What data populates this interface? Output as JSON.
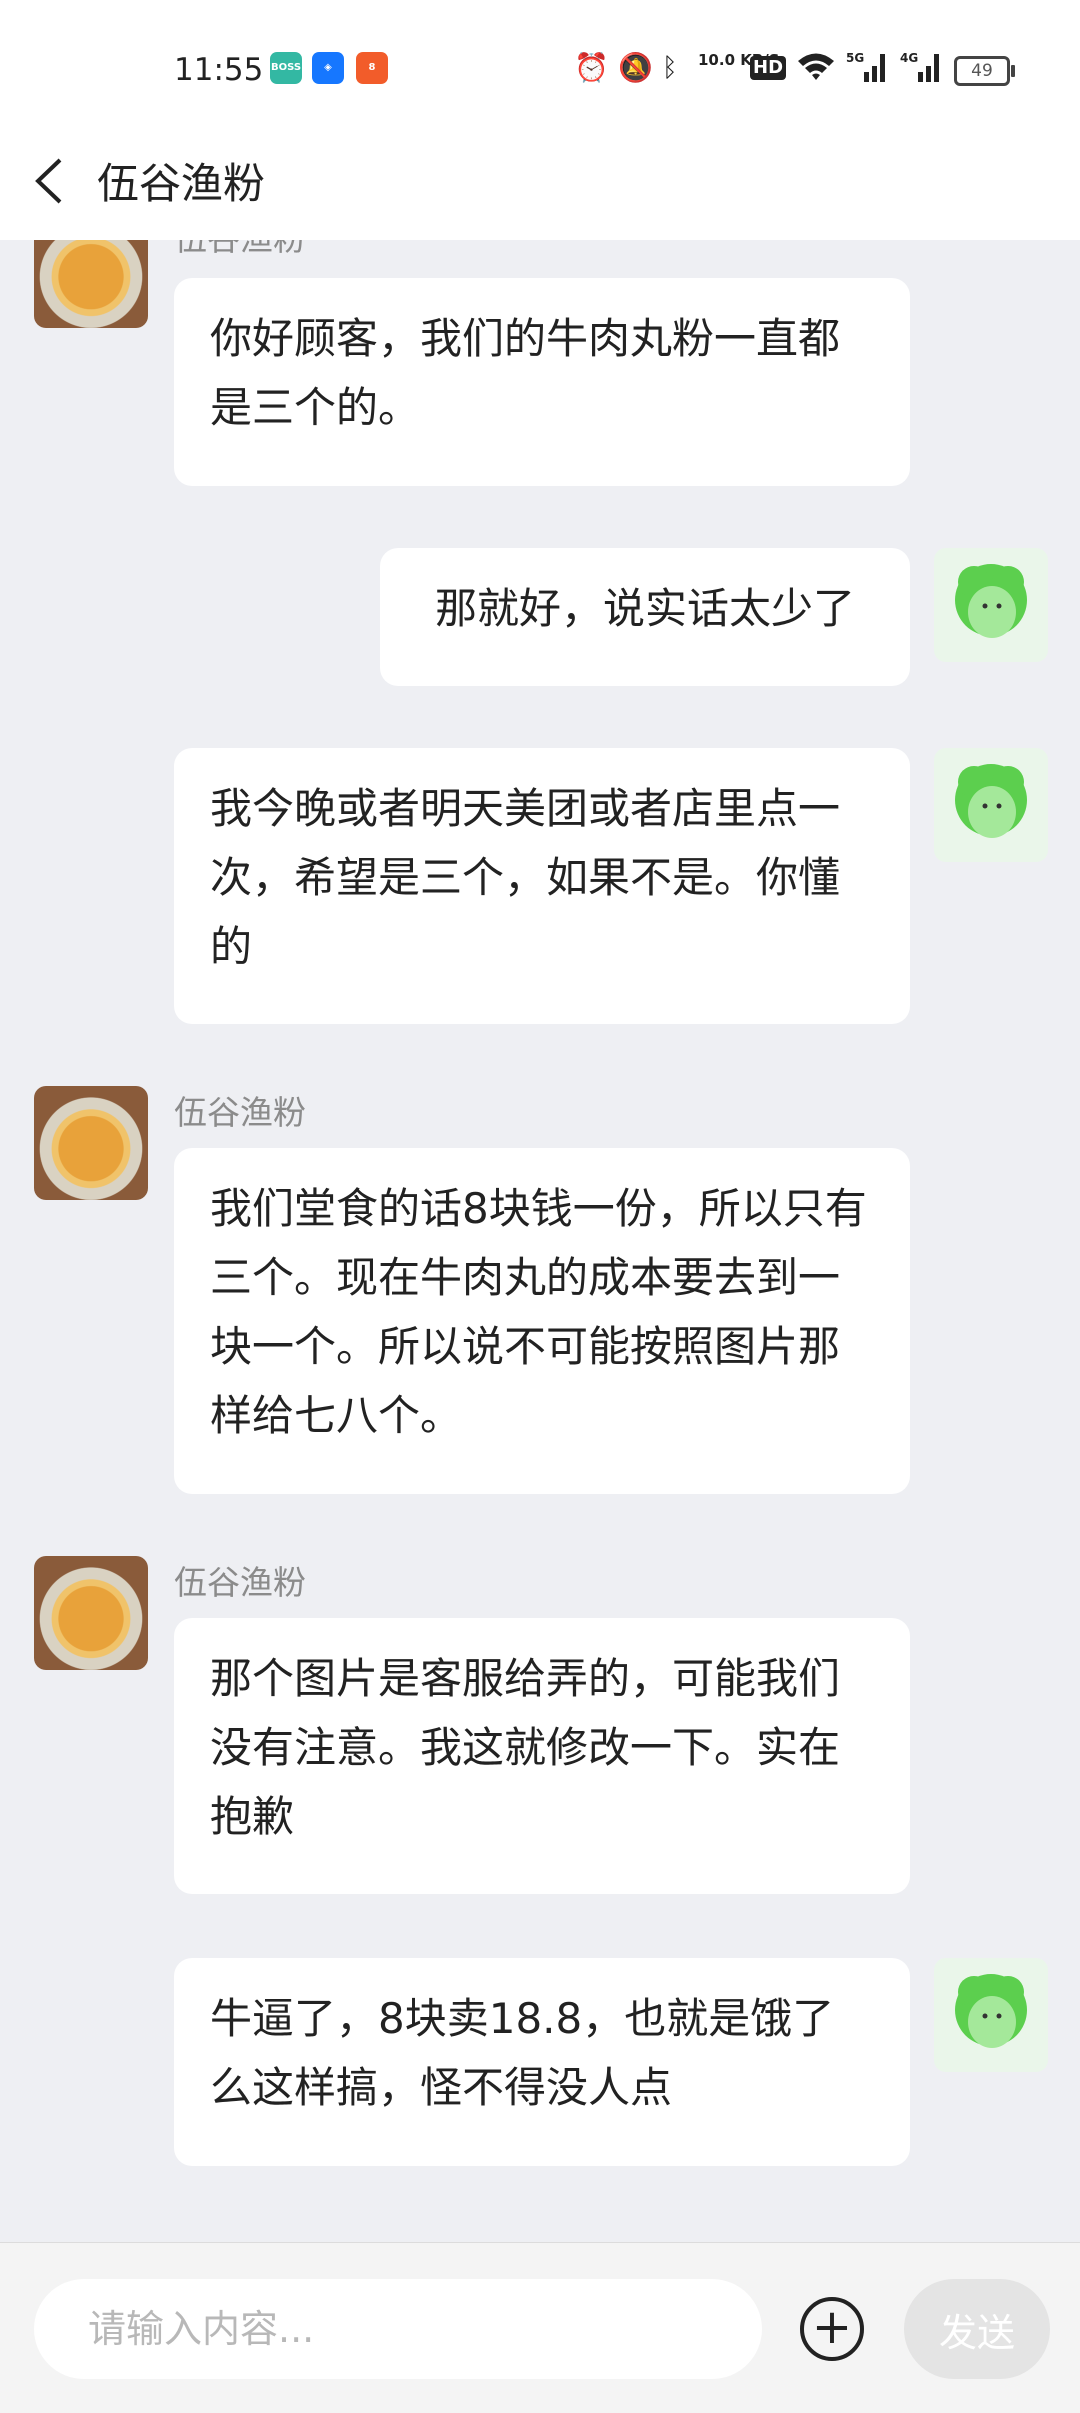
{
  "status_bar": {
    "time": "11:55",
    "app_icons": [
      "boss-zhipin-icon",
      "alipay-icon",
      "app-icon"
    ],
    "network_speed": "10.0 KB/S",
    "signal_labels": [
      "5G",
      "4G"
    ],
    "hd_label": "HD",
    "battery": "49"
  },
  "header": {
    "title": "伍谷渔粉"
  },
  "messages": [
    {
      "side": "left",
      "sender": "伍谷渔粉",
      "text": "你好顾客，我们的牛肉丸粉一直都是三个的。"
    },
    {
      "side": "right",
      "text": "那就好，说实话太少了"
    },
    {
      "side": "right",
      "text": "我今晚或者明天美团或者店里点一次，希望是三个，如果不是。你懂的"
    },
    {
      "side": "left",
      "sender": "伍谷渔粉",
      "text": "我们堂食的话8块钱一份，所以只有三个。现在牛肉丸的成本要去到一块一个。所以说不可能按照图片那样给七八个。"
    },
    {
      "side": "left",
      "sender": "伍谷渔粉",
      "text": "那个图片是客服给弄的，可能我们没有注意。我这就修改一下。实在抱歉"
    },
    {
      "side": "right",
      "text": "牛逼了，8块卖18.8，也就是饿了么这样搞，怪不得没人点"
    }
  ],
  "input_bar": {
    "placeholder": "请输入内容...",
    "send_label": "发送"
  },
  "colors": {
    "background": "#eeeff3",
    "bubble": "#ffffff",
    "avatar_user": "#7fd66e"
  }
}
